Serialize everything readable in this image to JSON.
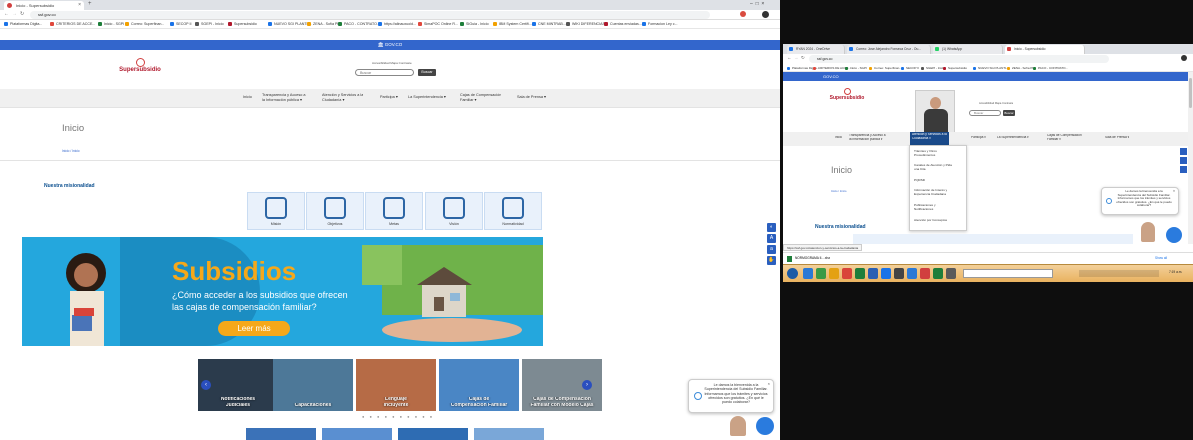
{
  "left": {
    "browser": {
      "tab_title": "Inicio - Supersubsidio",
      "new_tab": "+",
      "url": "ssf.gov.co",
      "window_controls": [
        "–",
        "□",
        "×"
      ],
      "bookmarks": [
        "Plataformas Digita...",
        "CRITERIOS DE ACCE...",
        "Inicio - SGPI",
        "Correo: Superfinan...",
        "SECOP II",
        "SGEPI - Inicio",
        "Supersubsidio",
        "NUEVO SGI PLANTL...",
        "ZENA - Sofía Plus",
        "PACO - CONTRATO...",
        "https://alinauxuoid...",
        "SimaPOC Online R...",
        "SIGuia - Inicio",
        "IBM System Certifi...",
        "CNE MINTRAB...",
        "WIKI DIFERENCIAS...",
        "Cuentas enviadas...",
        "Formacion Ley c..."
      ]
    },
    "site": {
      "gov_bar": "GOV.CO",
      "logo": "Supersubsidio",
      "topline": "Accesibilidad  Mapa  Contraste",
      "search_placeholder": "Buscar",
      "search_button": "Buscar",
      "nav": [
        "Inicio",
        "Transparencia y Acceso a\nla Información pública ▾",
        "Atención y Servicios a la\nCiudadanía ▾",
        "Participa ▾",
        "La Superintendencia ▾",
        "Cajas de Compensación\nFamiliar ▾",
        "Sala de Prensa ▾"
      ],
      "page_title": "Inicio",
      "breadcrumb": "Inicio / Inicio",
      "mission_title": "Nuestra misionalidad",
      "mission_cards": [
        "Misión",
        "Objetivos",
        "Metas",
        "Visión",
        "Normatividad"
      ],
      "banner": {
        "title": "Subsidios",
        "line1": "¿Cómo acceder a los subsidios que ofrecen",
        "line2": "las cajas de compensación familiar?",
        "button": "Leer más"
      },
      "slides": [
        "Notificaciones\nJudiciales",
        "Capacitaciones",
        "Lenguaje\nIncluyente",
        "Cajas de\nCompensación Familiar",
        "Cajas de Compensación\nFamiliar con Modelo Cajas"
      ],
      "chat_text": "Le damos la bienvenida a la Superintendencia del Subsidio Familiar. Informamos que los trámites y servicios ofrecidos son gratuitos. ¿En qué le puedo colaborar?",
      "chat_close": "×",
      "arrow_prev": "‹",
      "arrow_next": "›",
      "dots": "● ● ● ● ● ● ● ● ● ●"
    }
  },
  "right": {
    "tabs": [
      "RYAN 2024 - OneDrive",
      "Correo: Jose Alejandro Fonseca Cruz - Ou...",
      "(1) WhatsApp",
      "Inicio - Supersubsidio"
    ],
    "url": "ssf.gov.co",
    "bookmarks": [
      "Plataformas Digita...",
      "CRITERIOS DE ACCE...",
      "Inicio - SGPI",
      "Correo: Superfinan...",
      "SECOP II",
      "SGEPI - Inicio",
      "Supersubsidio",
      "NUEVO SGI PLANTL...",
      "ZENA - Sofía Plus",
      "PACO - CONTRATO..."
    ],
    "gov_bar": "GOV.CO",
    "logo": "Supersubsidio",
    "topline": "Accesibilidad  Mapa  Contraste",
    "search_placeholder": "Buscar",
    "search_button": "Buscar",
    "nav": [
      "Inicio",
      "Transparencia y Acceso a\nla Información pública ▾",
      "Atención y Servicios a la\nCiudadanía ▾",
      "Participa ▾",
      "La Superintendencia ▾",
      "Cajas de Compensación\nFamiliar ▾",
      "Sala de Prensa ▾"
    ],
    "dropdown": [
      "Trámites y Otros\nProcedimientos",
      "Canales de Atención y Pida\nuna Cita",
      "PQRSD",
      "Información de Interés y\nExperiencia Ciudadana",
      "Publicaciones y\nNotificaciones",
      "Atención por Conceptos"
    ],
    "page_title": "Inicio",
    "breadcrumb": "Inicio / Inicio",
    "mission_title": "Nuestra misionalidad",
    "chat_text": "Le damos la bienvenida a la Superintendencia del Subsidio Familiar. Informamos que los trámites y servicios ofrecidos son gratuitos. ¿En qué le puedo colaborar?",
    "status_url": "https://ssf.gov.co/atencion-y-servicios-a-la-ciudadania",
    "download_file": "NORMOGRAMA II....xlsx",
    "show_all": "Show all",
    "clock": "7:19 a.m."
  },
  "colors": {
    "gov_blue": "#3366cc",
    "brand_red": "#b0182c",
    "banner_blue": "#24a7dd",
    "banner_orange": "#f5a81a",
    "taskbar": "#e9b25f"
  }
}
